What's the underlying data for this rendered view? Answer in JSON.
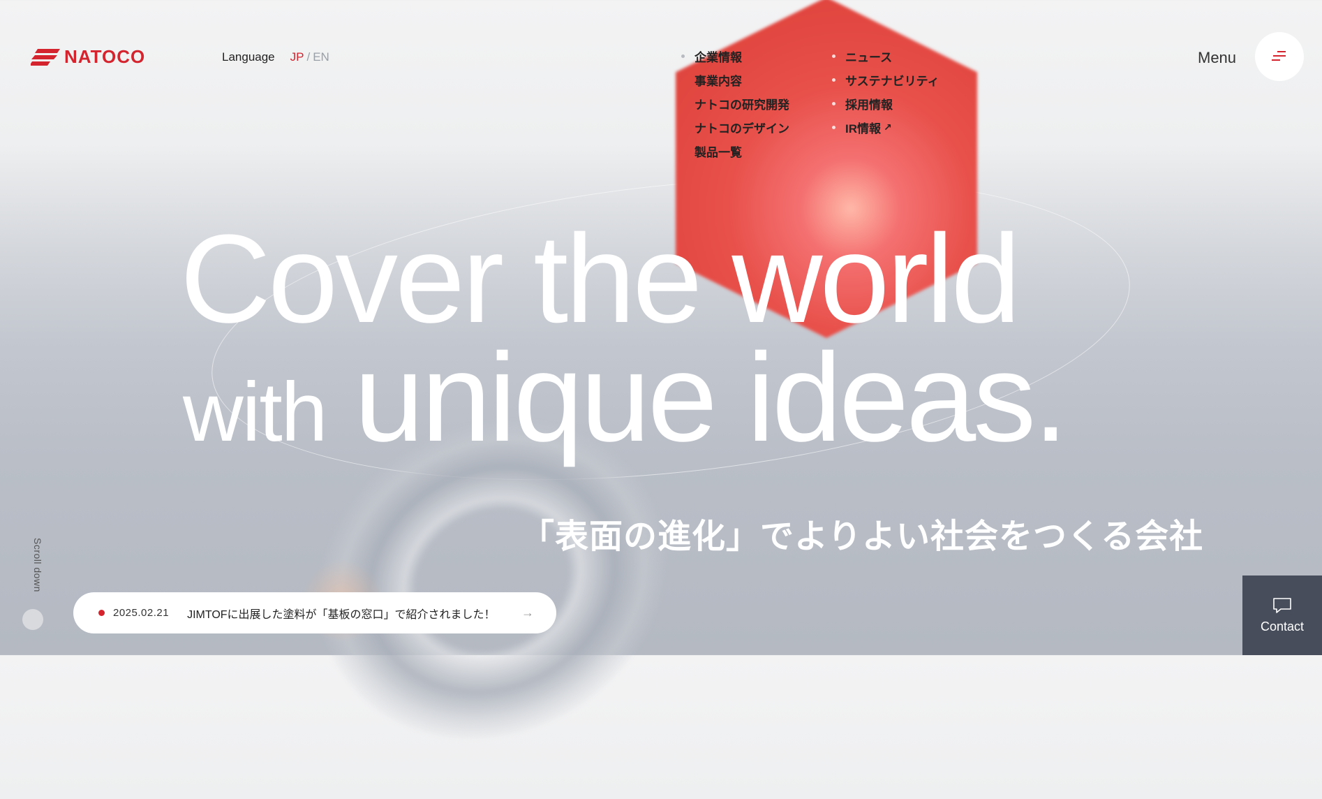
{
  "header": {
    "logo_text": "NATOCO",
    "language_label": "Language",
    "languages": {
      "jp": "JP",
      "separator": "/",
      "en": "EN",
      "active": "JP"
    },
    "menu_label": "Menu"
  },
  "nav": {
    "col1": [
      "企業情報",
      "事業内容",
      "ナトコの研究開発",
      "ナトコのデザイン",
      "製品一覧"
    ],
    "col2": [
      "ニュース",
      "サステナビリティ",
      "採用情報",
      "IR情報"
    ],
    "external_arrow": "↗"
  },
  "hero": {
    "line1": "Cover the world",
    "line2_light": "with",
    "line2_bold": "unique ideas.",
    "tagline": "「表面の進化」でよりよい社会をつくる会社"
  },
  "scroll": {
    "label": "Scroll down"
  },
  "news": {
    "date": "2025.02.21",
    "title": "JIMTOFに出展した塗料が「基板の窓口」で紹介されました！",
    "arrow": "→"
  },
  "contact": {
    "label": "Contact"
  },
  "colors": {
    "brand": "#d4242e",
    "contact_bg": "#474d5a"
  }
}
